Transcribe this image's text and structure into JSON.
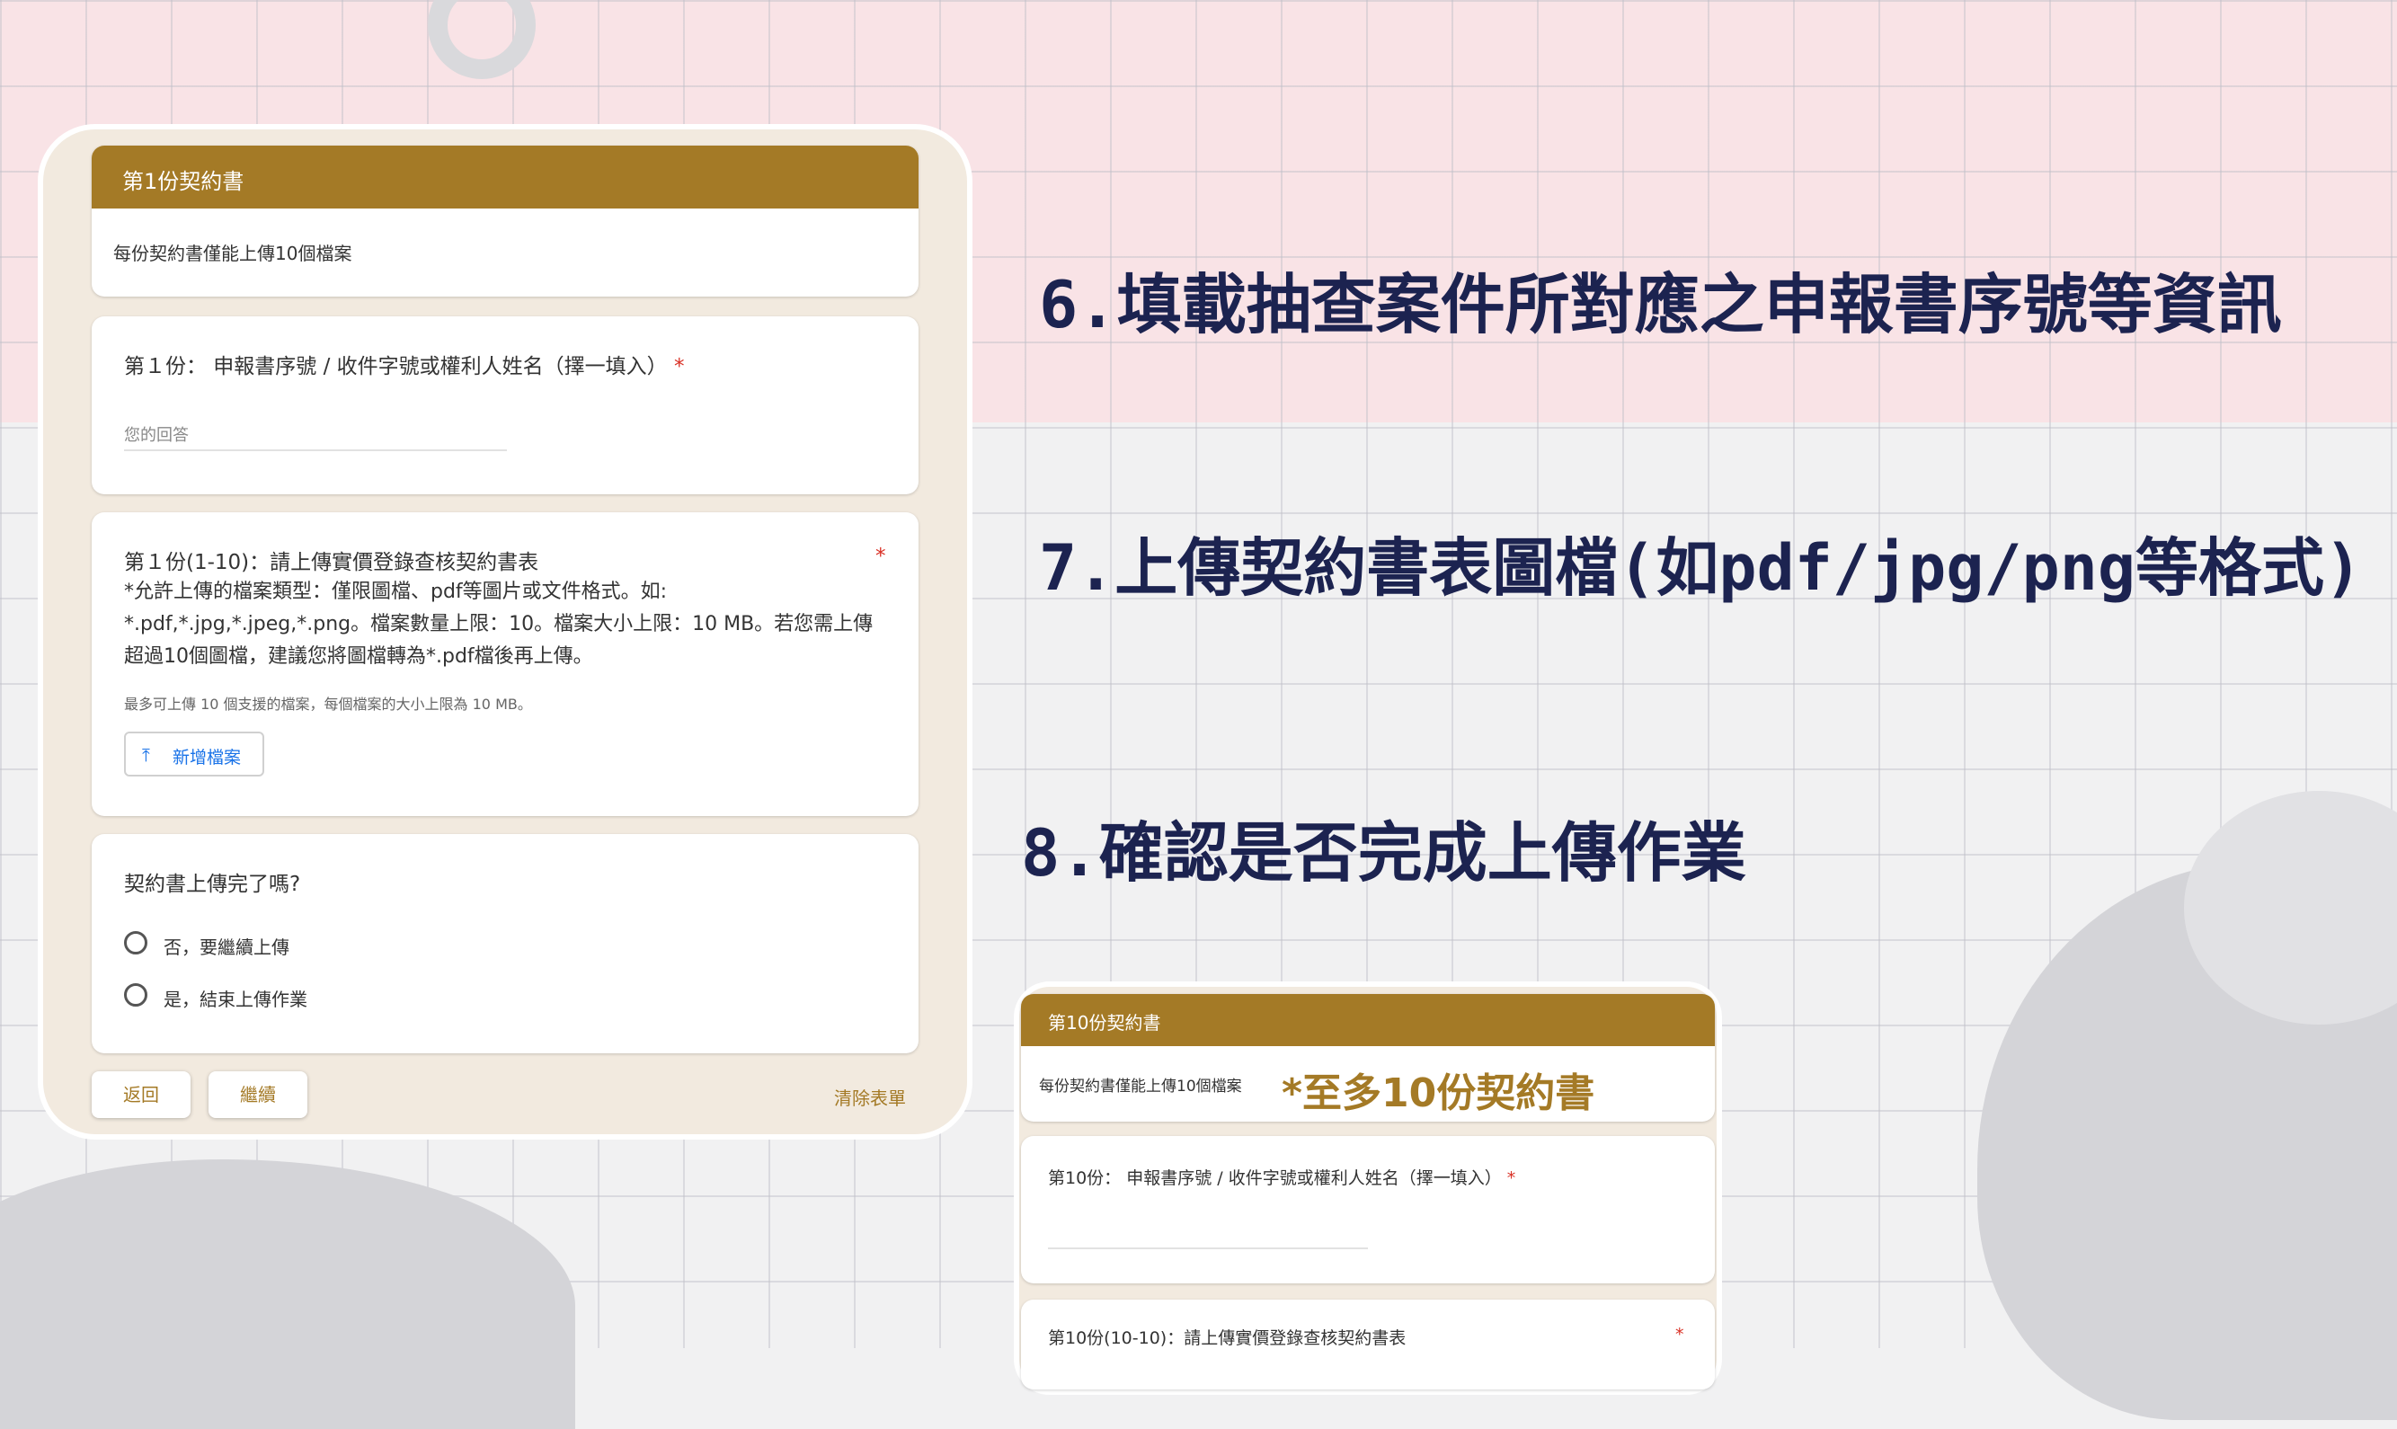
{
  "steps": [
    "6.填載抽查案件所對應之申報書序號等資訊",
    "7.上傳契約書表圖檔(如pdf/jpg/png等格式)",
    "8.確認是否完成上傳作業"
  ],
  "form1": {
    "header": "第1份契約書",
    "notice": "每份契約書僅能上傳10個檔案",
    "q1": {
      "label": "第１份： 申報書序號 / 收件字號或權利人姓名（擇一填入）",
      "required": "*",
      "placeholder": "您的回答"
    },
    "q2": {
      "title": "第１份(1-10)：請上傳實價登錄查核契約書表",
      "required": "*",
      "desc": [
        "*允許上傳的檔案類型：僅限圖檔、pdf等圖片或文件格式。如:",
        "*.pdf,*.jpg,*.jpeg,*.png。檔案數量上限：10。檔案大小上限：10 MB。若您需上傳",
        "超過10個圖檔，建議您將圖檔轉為*.pdf檔後再上傳。"
      ],
      "hint": "最多可上傳 10 個支援的檔案，每個檔案的大小上限為 10 MB。",
      "upload_label": "新增檔案"
    },
    "q3": {
      "title": "契約書上傳完了嗎?",
      "options": [
        "否，要繼續上傳",
        "是，結束上傳作業"
      ]
    },
    "buttons": {
      "back": "返回",
      "next": "繼續",
      "clear": "清除表單"
    }
  },
  "form2": {
    "header": "第10份契約書",
    "notice": "每份契約書僅能上傳10個檔案",
    "note": "*至多10份契約書",
    "q1": {
      "label": "第10份： 申報書序號 / 收件字號或權利人姓名（擇一填入）",
      "required": "*"
    },
    "q2": {
      "title": "第10份(10-10)：請上傳實價登錄查核契約書表",
      "required": "*"
    }
  },
  "colors": {
    "accent": "#a47a26",
    "step_text": "#1c2350",
    "panel": "#f2eadf",
    "required": "#d93025"
  },
  "icons": {
    "upload": "upload-icon"
  }
}
